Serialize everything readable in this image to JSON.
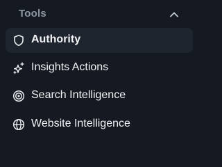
{
  "section": {
    "title": "Tools",
    "collapse_icon": "chevron-up-icon"
  },
  "items": [
    {
      "label": "Authority",
      "icon": "shield-icon",
      "active": true
    },
    {
      "label": "Insights Actions",
      "icon": "sparkles-icon",
      "active": false
    },
    {
      "label": "Search Intelligence",
      "icon": "target-icon",
      "active": false
    },
    {
      "label": "Website Intelligence",
      "icon": "globe-icon",
      "active": false
    }
  ],
  "colors": {
    "background": "#151a22",
    "active_background": "#1f252e",
    "header_text": "#8f96a1",
    "item_text": "#f1f3f5"
  }
}
